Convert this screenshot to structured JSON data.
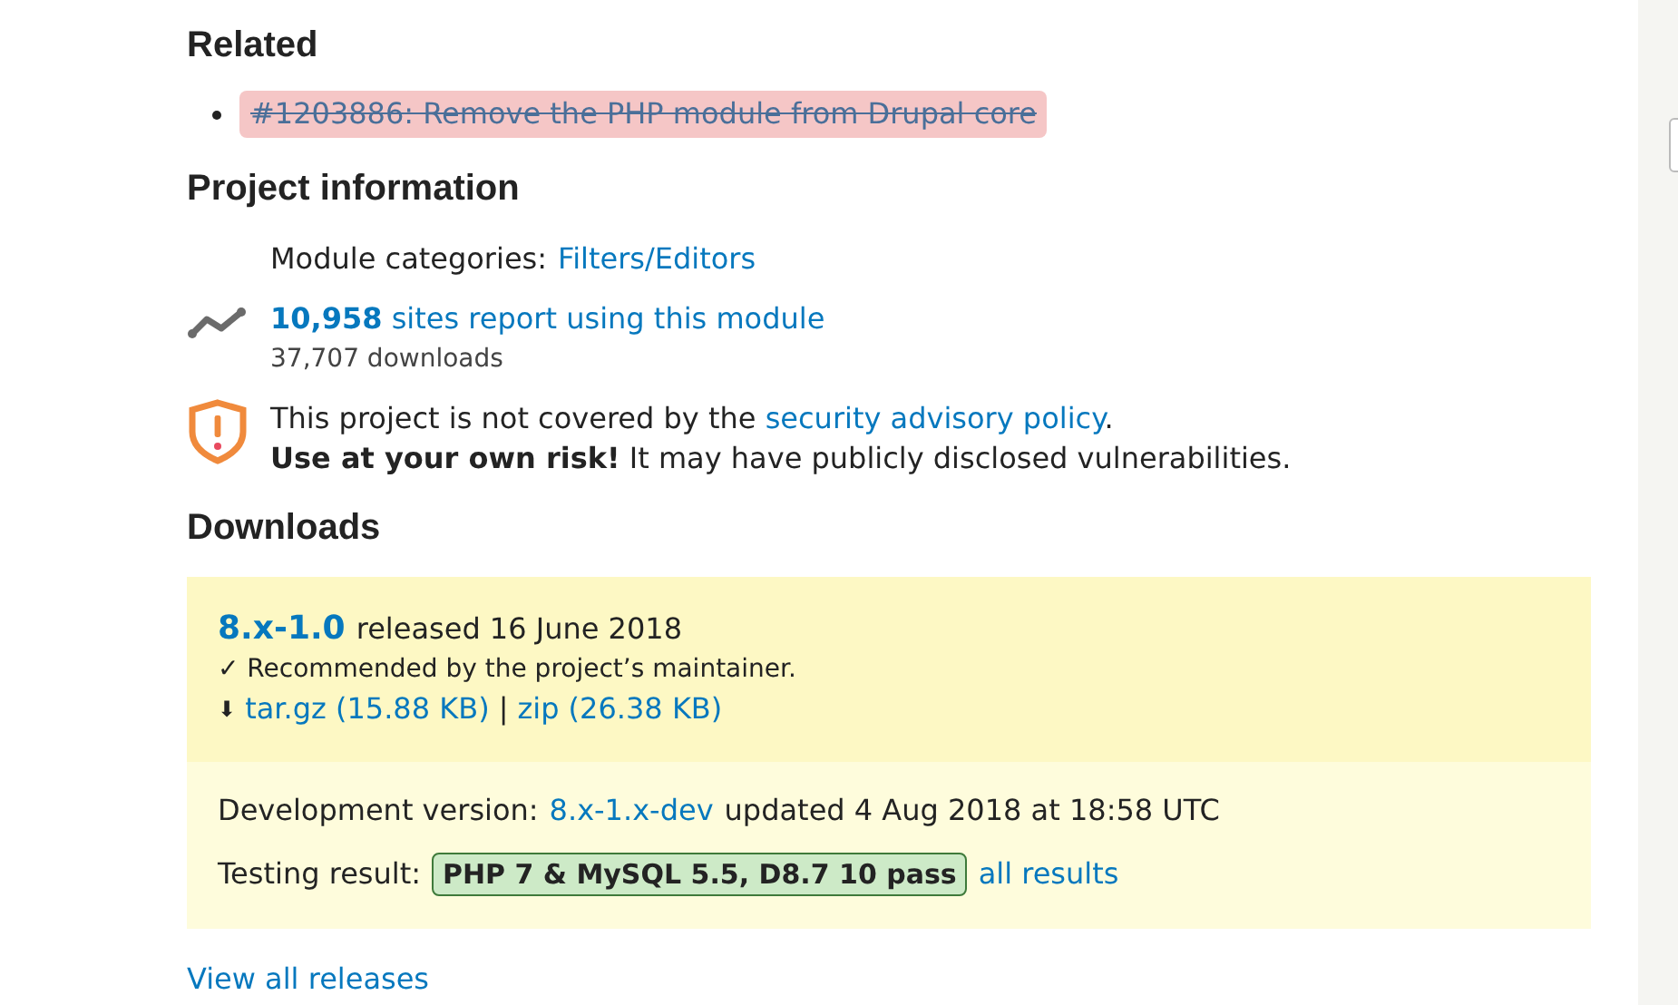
{
  "related": {
    "heading": "Related",
    "items": [
      {
        "text": "#1203886: Remove the PHP module from Drupal core",
        "closed": true
      }
    ]
  },
  "project_information": {
    "heading": "Project information",
    "categories_label": "Module categories:",
    "categories_link": "Filters/Editors",
    "usage_count": "10,958",
    "usage_text": "sites report using this module",
    "downloads": "37,707 downloads",
    "security_text": "This project is not covered by the",
    "security_link": "security advisory policy",
    "security_end": ".",
    "risk": "**Use at your own risk!** It may have publicly disclosed vulnerabilities."
  },
  "downloads": {
    "heading": "Downloads",
    "release": {
      "version": "8.x-1.0",
      "released": "released 16 June 2018",
      "recommended": "✓ Recommended by the project’s maintainer.",
      "arrow": "⬇",
      "files": [
        "tar.gz (15.88 KB)",
        "zip (26.38 KB)"
      ],
      "separator": "|"
    },
    "dev": {
      "label": "Development version:",
      "version": "8.x-1.x-dev",
      "updated": "updated 4 Aug 2018 at 18:58 UTC",
      "testing_label": "Testing result:",
      "badge": "PHP 7 & MySQL 5.5, D8.7 10 pass",
      "results_link": "all results"
    },
    "view_all": "View all releases"
  },
  "sidebar": [
    {
      "kind": "field"
    }
  ]
}
